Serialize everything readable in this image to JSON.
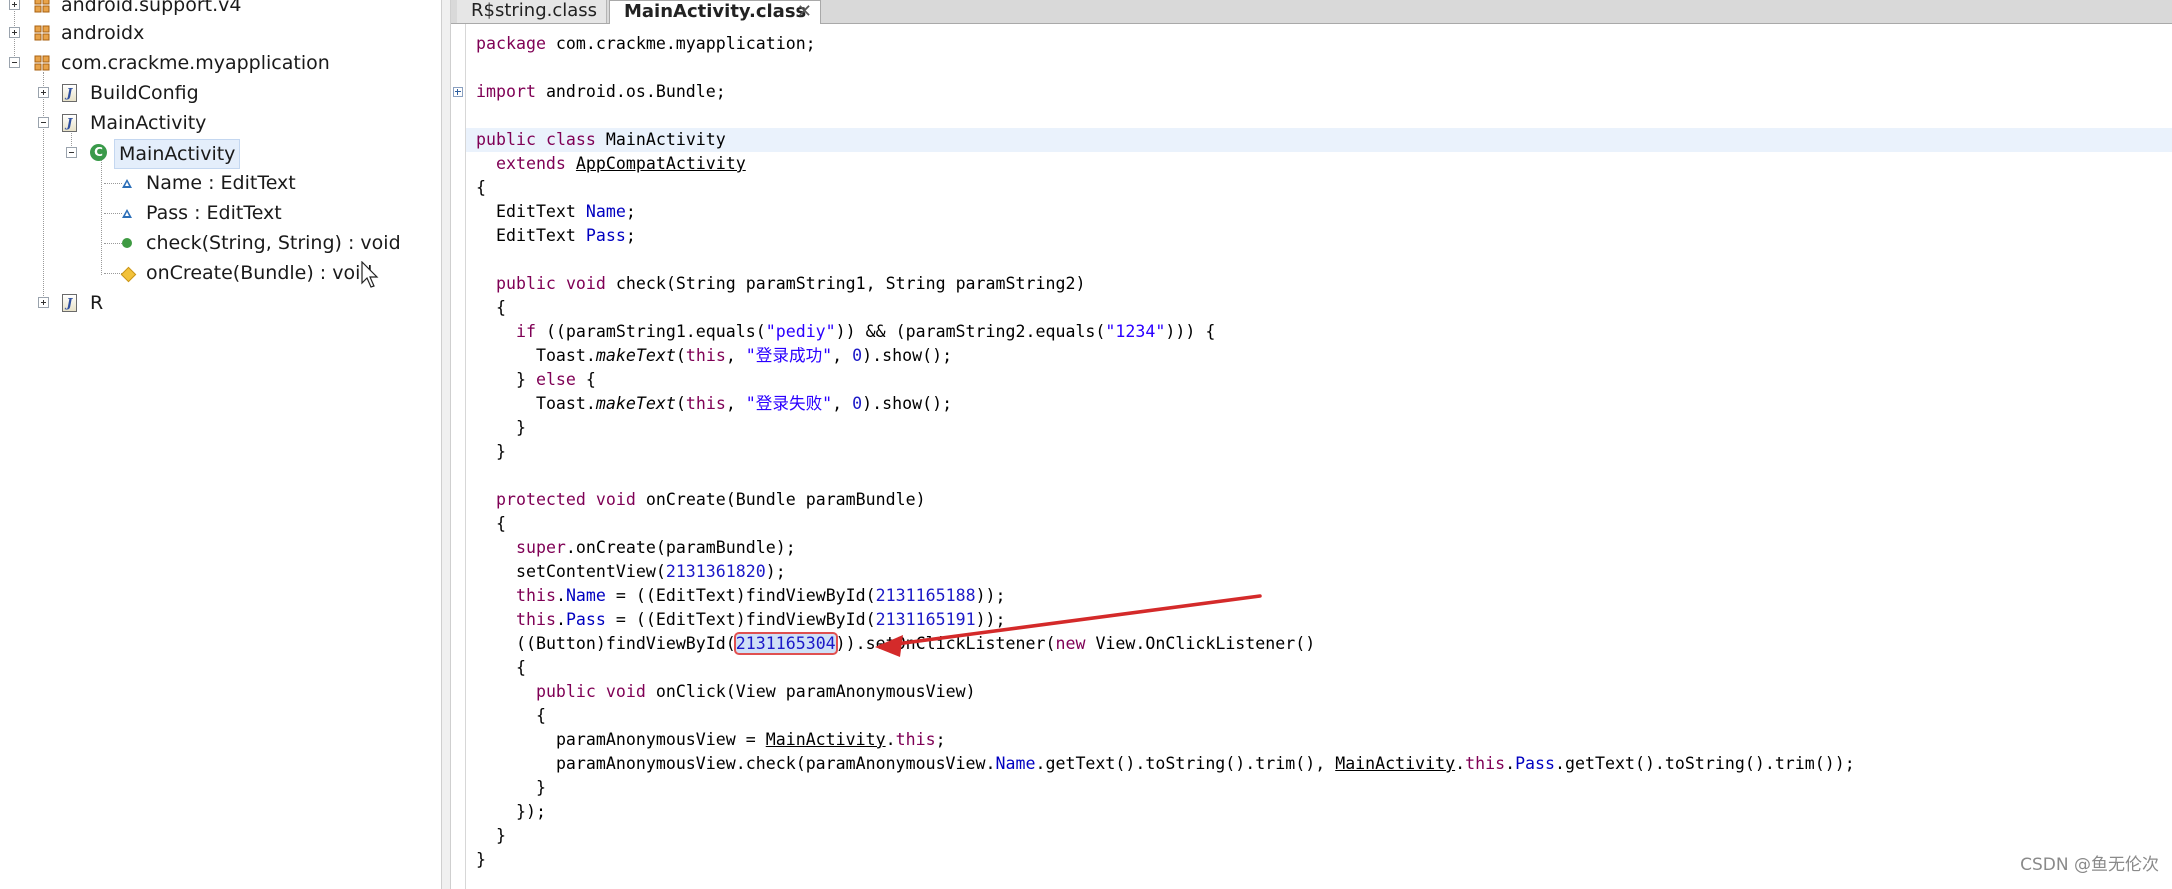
{
  "tree": {
    "items": [
      {
        "label": "android.support.v4"
      },
      {
        "label": "androidx"
      },
      {
        "label": "com.crackme.myapplication"
      },
      {
        "label": "BuildConfig"
      },
      {
        "label": "MainActivity"
      },
      {
        "label": "MainActivity"
      },
      {
        "label": "Name : EditText"
      },
      {
        "label": "Pass : EditText"
      },
      {
        "label": "check(String, String) : void"
      },
      {
        "label": "onCreate(Bundle) : void"
      },
      {
        "label": "R"
      }
    ]
  },
  "tabs": [
    {
      "label": "R$string.class",
      "active": false
    },
    {
      "label": "MainActivity.class",
      "active": true
    }
  ],
  "code": {
    "l1": {
      "kw": "package",
      "rest": " com.crackme.myapplication;"
    },
    "l2": {
      "kw": "import",
      "rest": " android.os.Bundle;"
    },
    "l3": {
      "kw1": "public",
      "kw2": "class",
      "rest": " MainActivity"
    },
    "l4": {
      "kw": "extends",
      "type": "AppCompatActivity"
    },
    "l5": {
      "text": "{"
    },
    "l6": {
      "pre": "EditText ",
      "field": "Name",
      "post": ";"
    },
    "l7": {
      "pre": "EditText ",
      "field": "Pass",
      "post": ";"
    },
    "l8": {
      "kw1": "public",
      "kw2": "void",
      "rest": " check(String paramString1, String paramString2)"
    },
    "l9": {
      "text": "{"
    },
    "l10": {
      "kw": "if",
      "a": " ((paramString1.equals(",
      "s1": "\"pediy\"",
      "b": ")) && (paramString2.equals(",
      "s2": "\"1234\"",
      "c": "))) {"
    },
    "l11": {
      "pre": "Toast.",
      "method": "makeText",
      "a": "(",
      "kw": "this",
      "b": ", ",
      "str": "\"登录成功\"",
      "c": ", ",
      "num": "0",
      "d": ").show();"
    },
    "l12": {
      "a": "} ",
      "kw": "else",
      "b": " {"
    },
    "l13": {
      "pre": "Toast.",
      "method": "makeText",
      "a": "(",
      "kw": "this",
      "b": ", ",
      "str": "\"登录失败\"",
      "c": ", ",
      "num": "0",
      "d": ").show();"
    },
    "l14": {
      "text": "}"
    },
    "l15": {
      "text": "}"
    },
    "l16": {
      "kw1": "protected",
      "kw2": "void",
      "rest": " onCreate(Bundle paramBundle)"
    },
    "l17": {
      "text": "{"
    },
    "l18": {
      "kw": "super",
      "rest": ".onCreate(paramBundle);"
    },
    "l19": {
      "pre": "setContentView(",
      "num": "2131361820",
      "post": ");"
    },
    "l20": {
      "kw": "this",
      "dot": ".",
      "field": "Name",
      "a": " = ((EditText)findViewById(",
      "num": "2131165188",
      "b": "));"
    },
    "l21": {
      "kw": "this",
      "dot": ".",
      "field": "Pass",
      "a": " = ((EditText)findViewById(",
      "num": "2131165191",
      "b": "));"
    },
    "l22": {
      "a": "((Button)findViewById(",
      "num": "2131165304",
      "b": ")).setOnClickListener(",
      "kw": "new",
      "c": " View.OnClickListener()"
    },
    "l23": {
      "text": "{"
    },
    "l24": {
      "kw1": "public",
      "kw2": "void",
      "rest": " onClick(View paramAnonymousView)"
    },
    "l25": {
      "text": "{"
    },
    "l26": {
      "a": "paramAnonymousView = ",
      "cls": "MainActivity",
      "dot": ".",
      "kw": "this",
      "b": ";"
    },
    "l27": {
      "a": "paramAnonymousView.check(paramAnonymousView.",
      "f1": "Name",
      "b": ".getText().toString().trim(), ",
      "cls": "MainActivity",
      "dot": ".",
      "kw": "this",
      "dot2": ".",
      "f2": "Pass",
      "c": ".getText().toString().trim());"
    },
    "l28": {
      "text": "}"
    },
    "l29": {
      "text": "});"
    },
    "l30": {
      "text": "}"
    },
    "l31": {
      "text": "}"
    }
  },
  "watermark": "CSDN @鱼无伦次",
  "colors": {
    "keyword": "#7f0055",
    "field": "#0000c0",
    "string": "#2a00ff",
    "number": "#1c19c7",
    "arrow": "#d42a2a",
    "highlight": "#eaf2fc"
  }
}
